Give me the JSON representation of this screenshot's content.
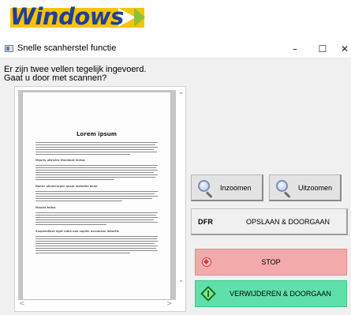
{
  "brand": {
    "text": "Windows"
  },
  "window": {
    "title": "Snelle scanherstel functie",
    "controls": {
      "minimize": "–",
      "maximize": "☐",
      "close": "✕"
    }
  },
  "message": {
    "line1": "Er zijn twee vellen tegelijk ingevoerd.",
    "line2": "Gaat u door met scannen?"
  },
  "preview": {
    "document_title": "Lorem ipsum",
    "headings": [
      "Mauris ultricies tincidunt lectus",
      "Donec ullamcorper quam molestie dolor",
      "Mauris tellus",
      "Suspendisse eget nulla non sapien accumsan lobortis"
    ]
  },
  "buttons": {
    "zoom_in": "Inzoomen",
    "zoom_out": "Uitzoomen",
    "dfr": "DFR",
    "save_continue": "OPSLAAN & DOORGAAN",
    "stop": "STOP",
    "delete_continue": "VERWIJDEREN & DOORGAAN"
  },
  "icons": {
    "zoom_in": "magnifier-icon",
    "zoom_out": "magnifier-icon",
    "stop": "stop-icon",
    "delete": "diamond-go-icon",
    "app": "scanner-app-icon"
  },
  "colors": {
    "stop_button": "#f2aaaa",
    "delete_button": "#5fe0a8",
    "brand_blue": "#1f3f9a",
    "brand_yellow": "#f6c400"
  }
}
